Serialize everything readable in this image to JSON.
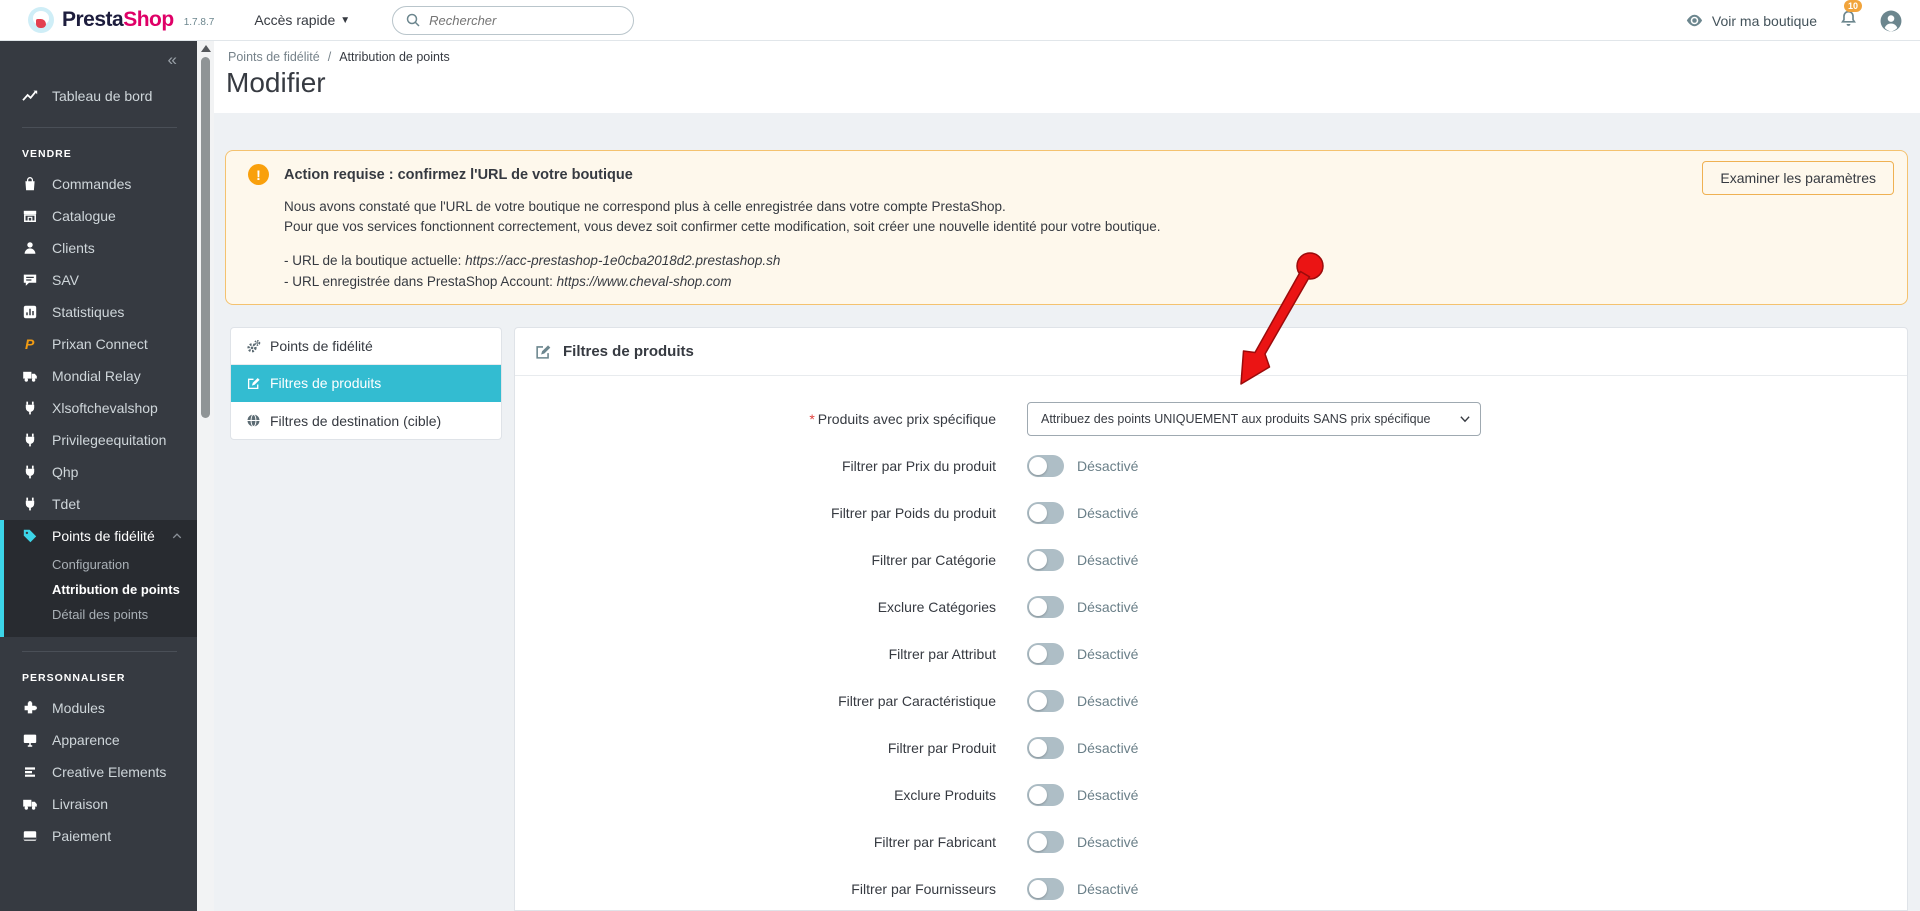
{
  "topbar": {
    "brand_presta": "Presta",
    "brand_shop": "Shop",
    "version": "1.7.8.7",
    "quick_access": "Accès rapide",
    "quick_access_caret": "▼",
    "search_placeholder": "Rechercher",
    "view_shop": "Voir ma boutique",
    "notifications_count": "10"
  },
  "breadcrumb": {
    "parent": "Points de fidélité",
    "separator": "/",
    "current": "Attribution de points"
  },
  "page": {
    "title": "Modifier"
  },
  "alert": {
    "icon_glyph": "!",
    "title": "Action requise : confirmez l'URL de votre boutique",
    "line1": "Nous avons constaté que l'URL de votre boutique ne correspond plus à celle enregistrée dans votre compte PrestaShop.",
    "line2": "Pour que vos services fonctionnent correctement, vous devez soit confirmer cette modification, soit créer une nouvelle identité pour votre boutique.",
    "url_current_label": "- URL de la boutique actuelle: ",
    "url_current": "https://acc-prestashop-1e0cba2018d2.prestashop.sh",
    "url_account_label": "- URL enregistrée dans PrestaShop Account: ",
    "url_account": "https://www.cheval-shop.com",
    "button": "Examiner les paramètres"
  },
  "sidebar": {
    "collapse": "«",
    "dashboard": {
      "label": "Tableau de bord",
      "icon": "trend"
    },
    "sections": [
      {
        "title": "VENDRE",
        "items": [
          {
            "label": "Commandes",
            "icon": "bag"
          },
          {
            "label": "Catalogue",
            "icon": "store"
          },
          {
            "label": "Clients",
            "icon": "person"
          },
          {
            "label": "SAV",
            "icon": "chat"
          },
          {
            "label": "Statistiques",
            "icon": "stats"
          },
          {
            "label": "Prixan Connect",
            "icon": "prixan"
          },
          {
            "label": "Mondial Relay",
            "icon": "truck"
          },
          {
            "label": "Xlsoftchevalshop",
            "icon": "plug"
          },
          {
            "label": "Privilegeequitation",
            "icon": "plug"
          },
          {
            "label": "Qhp",
            "icon": "plug"
          },
          {
            "label": "Tdet",
            "icon": "plug"
          },
          {
            "label": "Points de fidélité",
            "icon": "tag",
            "active": true,
            "submenu": [
              "Configuration",
              "Attribution de points",
              "Détail des points"
            ],
            "active_sub": "Attribution de points"
          }
        ]
      },
      {
        "title": "PERSONNALISER",
        "items": [
          {
            "label": "Modules",
            "icon": "puzzle"
          },
          {
            "label": "Apparence",
            "icon": "monitor"
          },
          {
            "label": "Creative Elements",
            "icon": "bars"
          },
          {
            "label": "Livraison",
            "icon": "truck"
          },
          {
            "label": "Paiement",
            "icon": "card"
          }
        ]
      }
    ]
  },
  "tabs": [
    {
      "label": "Points de fidélité",
      "icon": "gears",
      "active": false
    },
    {
      "label": "Filtres de produits",
      "icon": "edit",
      "active": true
    },
    {
      "label": "Filtres de destination (cible)",
      "icon": "globe",
      "active": false
    }
  ],
  "panel": {
    "title": "Filtres de produits",
    "select_row": {
      "required_mark": "*",
      "label": "Produits avec prix spécifique",
      "value": "Attribuez des points UNIQUEMENT aux produits SANS prix spécifique"
    },
    "toggle_rows": [
      {
        "label": "Filtrer par Prix du produit",
        "state": "Désactivé"
      },
      {
        "label": "Filtrer par Poids du produit",
        "state": "Désactivé"
      },
      {
        "label": "Filtrer par Catégorie",
        "state": "Désactivé"
      },
      {
        "label": "Exclure Catégories",
        "state": "Désactivé"
      },
      {
        "label": "Filtrer par Attribut",
        "state": "Désactivé"
      },
      {
        "label": "Filtrer par Caractéristique",
        "state": "Désactivé"
      },
      {
        "label": "Filtrer par Produit",
        "state": "Désactivé"
      },
      {
        "label": "Exclure Produits",
        "state": "Désactivé"
      },
      {
        "label": "Filtrer par Fabricant",
        "state": "Désactivé"
      },
      {
        "label": "Filtrer par Fournisseurs",
        "state": "Désactivé"
      }
    ]
  },
  "colors": {
    "accent_teal": "#33bcd1",
    "sidebar_accent": "#3cd5e8",
    "brand_pink": "#df0067",
    "warning_orange": "#f9a00c",
    "alert_border": "#f4c26f",
    "arrow_red": "#eb1414",
    "prixan_orange": "#f39c12"
  }
}
